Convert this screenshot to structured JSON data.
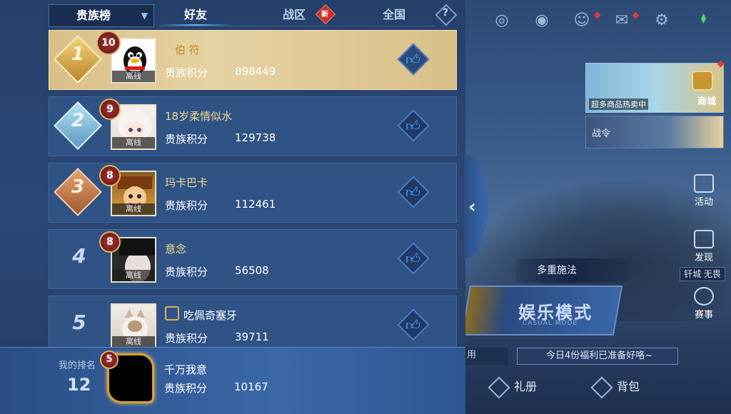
{
  "leaderboard": {
    "board_select": "贵族榜",
    "tabs": [
      {
        "label": "好友",
        "active": true
      },
      {
        "label": "战区",
        "badge": "新"
      },
      {
        "label": "全国"
      }
    ],
    "help": "?",
    "score_label": "贵族积分",
    "offline_label": "离线",
    "rows": [
      {
        "rank": "1",
        "level": "10",
        "name": "伯 符",
        "score": "898449"
      },
      {
        "rank": "2",
        "level": "9",
        "name": "18岁柔情似水",
        "score": "129738"
      },
      {
        "rank": "3",
        "level": "8",
        "name": "玛卡巴卡",
        "score": "112461"
      },
      {
        "rank": "4",
        "level": "8",
        "name": "意念",
        "score": "56508"
      },
      {
        "rank": "5",
        "level": "",
        "name": "吃佩奇塞牙",
        "score": "39711"
      }
    ],
    "my_rank": {
      "label": "我的排名",
      "rank": "12",
      "level": "5",
      "name": "千万我意",
      "score": "10167"
    }
  },
  "game_hud": {
    "shop_promo": "超多商品热卖中",
    "shop_label": "商城",
    "war_order": "战令",
    "activity": "活动",
    "discover": "发现",
    "event_tag": "钎城 无畏",
    "events": "赛事",
    "multi_cast": "多重施法",
    "casual_title": "娱乐模式",
    "casual_sub": "CASUAL MODE",
    "welfare_left": "用",
    "welfare": "今日4份福利已准备好咯~",
    "gift": "礼册",
    "backpack": "背包"
  },
  "colors": {
    "panel_bg": "#2a4774",
    "row_bg": "#2f5385",
    "first_row_bg": "#e6d2a2",
    "like_blue": "#5aa8ff",
    "name_gold": "#f2d890"
  }
}
